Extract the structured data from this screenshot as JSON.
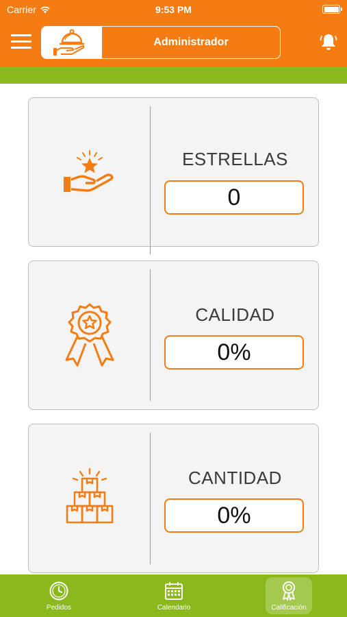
{
  "status_bar": {
    "carrier": "Carrier",
    "time": "9:53 PM"
  },
  "header": {
    "title": "Administrador",
    "background_color": "#f47c12",
    "logo_icon": "serving-platter-icon"
  },
  "accent_strip_color": "#8ab81d",
  "cards": [
    {
      "label": "ESTRELLAS",
      "value": "0",
      "icon": "hand-star-icon"
    },
    {
      "label": "CALIDAD",
      "value": "0%",
      "icon": "award-ribbon-icon"
    },
    {
      "label": "CANTIDAD",
      "value": "0%",
      "icon": "stacked-boxes-icon"
    }
  ],
  "tab_bar": {
    "tabs": [
      {
        "label": "Pedidos",
        "icon": "clock-icon"
      },
      {
        "label": "Calendario",
        "icon": "calendar-icon"
      },
      {
        "label": "Calificación",
        "icon": "rosette-icon",
        "active": true
      }
    ]
  },
  "colors": {
    "primary": "#f47c12",
    "secondary": "#8ab81d"
  }
}
